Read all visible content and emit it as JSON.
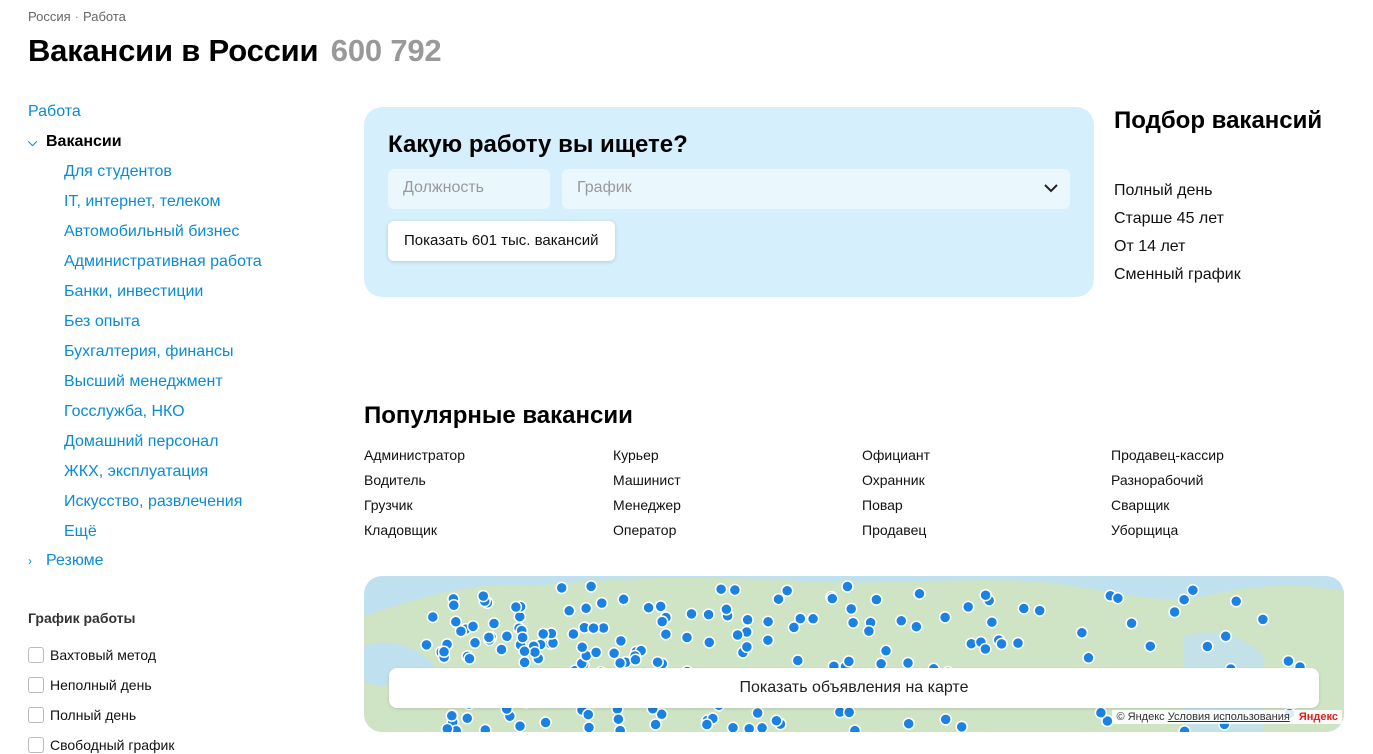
{
  "breadcrumb": {
    "items": [
      "Россия",
      "Работа"
    ],
    "sep": "·"
  },
  "title": {
    "text": "Вакансии в России",
    "count": "600 792"
  },
  "sidebar": {
    "root": "Работа",
    "section": "Вакансии",
    "items": [
      "Для студентов",
      "IT, интернет, телеком",
      "Автомобильный бизнес",
      "Административная работа",
      "Банки, инвестиции",
      "Без опыта",
      "Бухгалтерия, финансы",
      "Высший менеджмент",
      "Госслужба, НКО",
      "Домашний персонал",
      "ЖКХ, эксплуатация",
      "Искусство, развлечения",
      "Ещё"
    ],
    "resume": "Резюме"
  },
  "filter": {
    "title": "График работы",
    "options": [
      "Вахтовый метод",
      "Неполный день",
      "Полный день",
      "Свободный график"
    ]
  },
  "search": {
    "title": "Какую работу вы ищете?",
    "position_placeholder": "Должность",
    "schedule_placeholder": "График",
    "button": "Показать 601 тыс. вакансий"
  },
  "picker": {
    "title": "Подбор вакансий",
    "items": [
      "Полный день",
      "Старше 45 лет",
      "От 14 лет",
      "Сменный график"
    ]
  },
  "popular": {
    "title": "Популярные вакансии",
    "items": [
      "Администратор",
      "Курьер",
      "Официант",
      "Продавец-кассир",
      "Водитель",
      "Машинист",
      "Охранник",
      "Разнорабочий",
      "Грузчик",
      "Менеджер",
      "Повар",
      "Сварщик",
      "Кладовщик",
      "Оператор",
      "Продавец",
      "Уборщица"
    ]
  },
  "map": {
    "button": "Показать объявления на карте",
    "attribution": "© Яндекс",
    "terms": "Условия использования",
    "logo": "Яндекс",
    "colors": {
      "water": "#bfe0ee",
      "land": "#cfe3c5",
      "marker": "#1a82e2"
    }
  },
  "colors": {
    "link": "#0a8bd6",
    "card": "#d6effc",
    "count": "#999999"
  }
}
